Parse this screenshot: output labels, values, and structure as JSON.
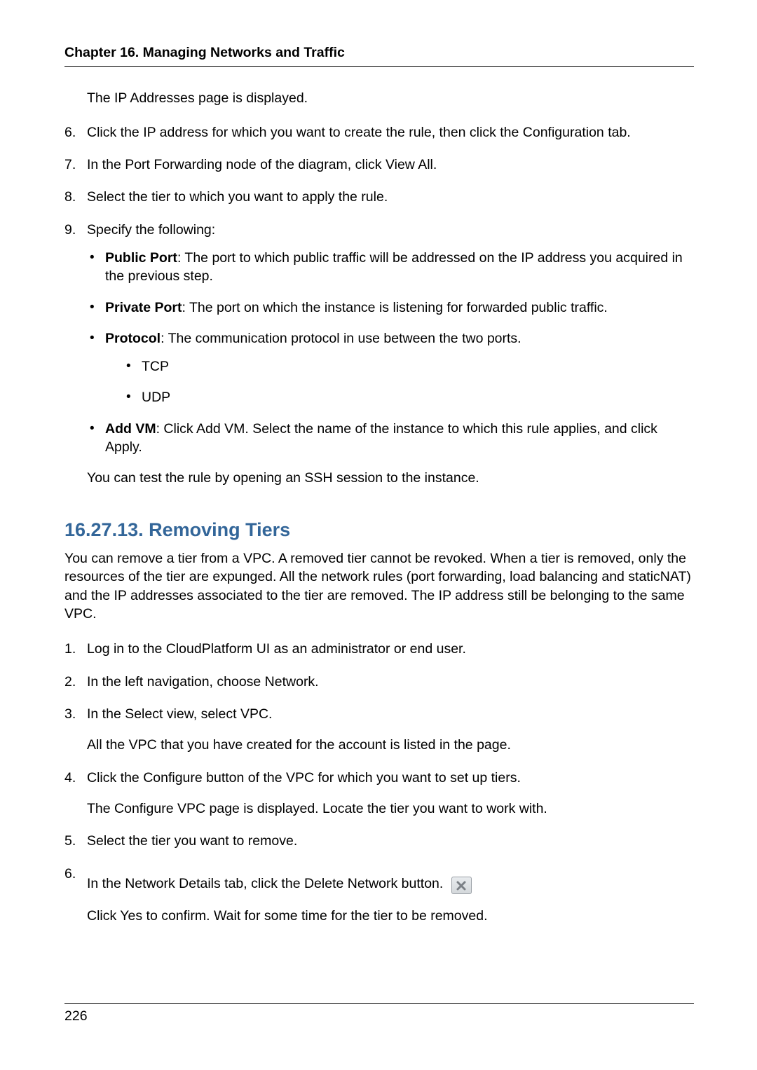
{
  "header": {
    "running_head": "Chapter 16. Managing Networks and Traffic"
  },
  "upper": {
    "intro_line": "The IP Addresses page is displayed.",
    "step6_num": "6.",
    "step6": "Click the IP address for which you want to create the rule, then click the Configuration tab.",
    "step7_num": "7.",
    "step7": "In the Port Forwarding node of the diagram, click View All.",
    "step8_num": "8.",
    "step8": "Select the tier to which you want to apply the rule.",
    "step9_num": "9.",
    "step9": "Specify the following:",
    "bullets": {
      "public_port_label": "Public Port",
      "public_port_text": ": The port to which public traffic will be addressed on the IP address you acquired in the previous step.",
      "private_port_label": "Private Port",
      "private_port_text": ": The port on which the instance is listening for forwarded public traffic.",
      "protocol_label": "Protocol",
      "protocol_text": ": The communication protocol in use between the two ports.",
      "protocol_tcp": "TCP",
      "protocol_udp": "UDP",
      "add_vm_label": "Add VM",
      "add_vm_text": ": Click Add VM. Select the name of the instance to which this rule applies, and click Apply."
    },
    "closing": "You can test the rule by opening an SSH session to the instance."
  },
  "section": {
    "heading": "16.27.13. Removing Tiers",
    "intro": "You can remove a tier from a VPC. A removed tier cannot be revoked. When a tier is removed, only the resources of the tier are expunged. All the network rules (port forwarding, load balancing and staticNAT) and the IP addresses associated to the tier are removed. The IP address still be belonging to the same VPC.",
    "s1_num": "1.",
    "s1": "Log in to the CloudPlatform UI as an administrator or end user.",
    "s2_num": "2.",
    "s2": "In the left navigation, choose Network.",
    "s3_num": "3.",
    "s3": "In the Select view, select VPC.",
    "s3_cont": "All the VPC that you have created for the account is listed in the page.",
    "s4_num": "4.",
    "s4": "Click the Configure button of the VPC for which you want to set up tiers.",
    "s4_cont": "The Configure VPC page is displayed. Locate the tier you want to work with.",
    "s5_num": "5.",
    "s5": "Select the tier you want to remove.",
    "s6_num": "6.",
    "s6_line1": "In the Network Details tab, click the Delete Network button.",
    "s6_line2": "Click Yes to confirm. Wait for some time for the tier to be removed."
  },
  "footer": {
    "page_number": "226"
  }
}
